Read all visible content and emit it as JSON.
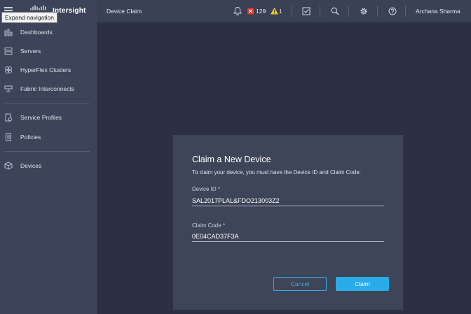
{
  "header": {
    "brand": "Intersight",
    "page_title": "Device Claim",
    "critical_alarm_count": "129",
    "warning_alarm_count": "1",
    "user_name": "Archana Sharma",
    "tooltip": "Expand navigation",
    "icons": [
      "hamburger-icon",
      "cisco-logo",
      "bell-icon",
      "critical-alarm-icon",
      "warning-alarm-icon",
      "tasks-icon",
      "search-icon",
      "gear-icon",
      "help-icon"
    ]
  },
  "sidebar": {
    "items": [
      {
        "label": "Dashboards",
        "icon": "dashboards-icon"
      },
      {
        "label": "Servers",
        "icon": "servers-icon"
      },
      {
        "label": "HyperFlex Clusters",
        "icon": "hyperflex-icon"
      },
      {
        "label": "Fabric Interconnects",
        "icon": "fabric-icon"
      },
      {
        "label": "Service Profiles",
        "icon": "service-profiles-icon"
      },
      {
        "label": "Policies",
        "icon": "policies-icon"
      },
      {
        "label": "Devices",
        "icon": "devices-icon"
      }
    ]
  },
  "modal": {
    "title": "Claim a New Device",
    "description": "To claim your device, you must have the Device ID and Claim Code.",
    "device_id_label": "Device ID *",
    "device_id_value": "SAL2017PLAL&FDO213003Z2",
    "claim_code_label": "Claim Code *",
    "claim_code_value": "0E04CAD37F3A",
    "cancel_label": "Cancel",
    "claim_label": "Claim"
  },
  "colors": {
    "background": "#2b3142",
    "sidebar": "#3d4459",
    "modal": "#3e4558",
    "accent": "#29abe8",
    "critical": "#e2352b",
    "warning": "#f5c518"
  }
}
